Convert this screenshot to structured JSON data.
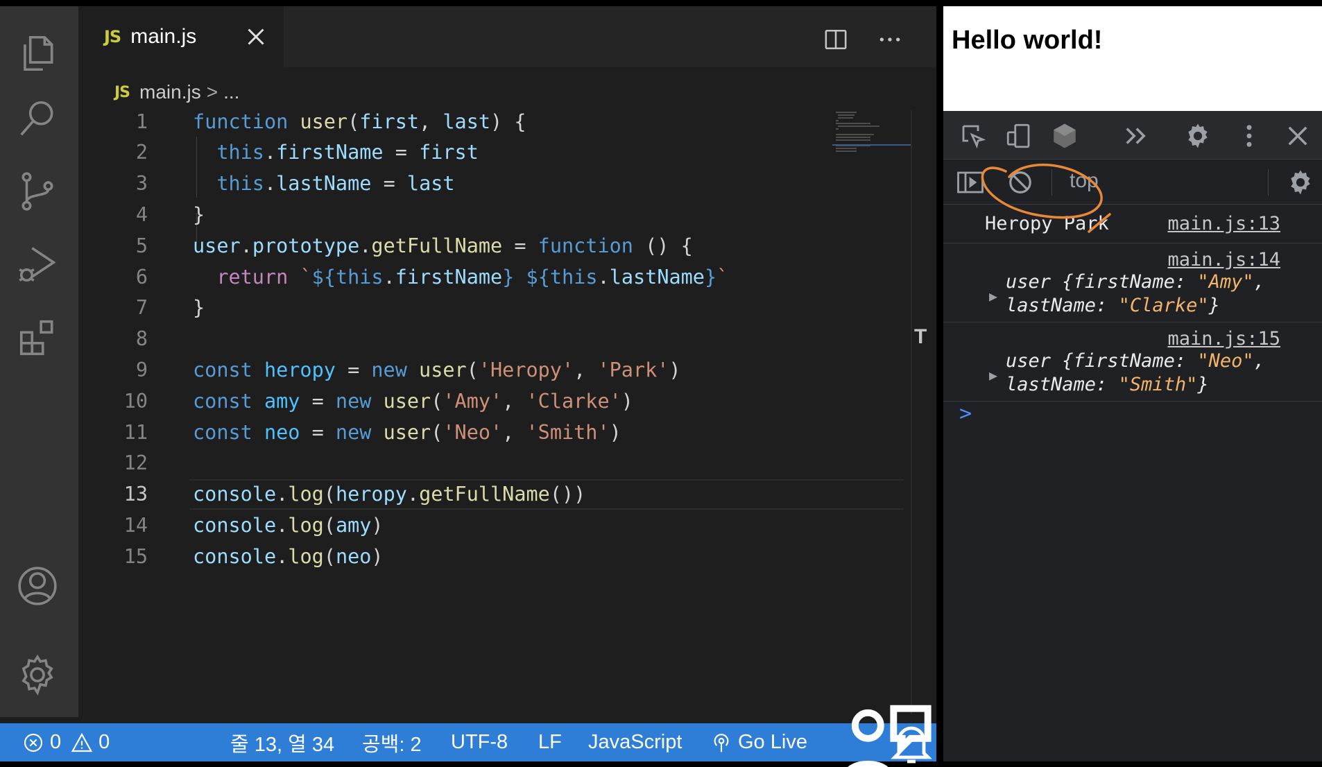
{
  "editor": {
    "tab": {
      "badge": "JS",
      "label": "main.js"
    },
    "breadcrumb": {
      "badge": "JS",
      "file": "main.js",
      "separator": ">",
      "more": "..."
    },
    "lines": [
      {
        "n": "1",
        "tokens": [
          [
            "kw",
            "function "
          ],
          [
            "fn",
            "user"
          ],
          [
            "pun",
            "("
          ],
          [
            "var",
            "first"
          ],
          [
            "pun",
            ", "
          ],
          [
            "var",
            "last"
          ],
          [
            "pun",
            ") {"
          ]
        ]
      },
      {
        "n": "2",
        "tokens": [
          [
            "pun",
            "  "
          ],
          [
            "kw",
            "this"
          ],
          [
            "pun",
            "."
          ],
          [
            "var",
            "firstName"
          ],
          [
            "pun",
            " = "
          ],
          [
            "var",
            "first"
          ]
        ]
      },
      {
        "n": "3",
        "tokens": [
          [
            "pun",
            "  "
          ],
          [
            "kw",
            "this"
          ],
          [
            "pun",
            "."
          ],
          [
            "var",
            "lastName"
          ],
          [
            "pun",
            " = "
          ],
          [
            "var",
            "last"
          ]
        ]
      },
      {
        "n": "4",
        "tokens": [
          [
            "pun",
            "}"
          ]
        ]
      },
      {
        "n": "5",
        "tokens": [
          [
            "var",
            "user"
          ],
          [
            "pun",
            "."
          ],
          [
            "var",
            "prototype"
          ],
          [
            "pun",
            "."
          ],
          [
            "fn",
            "getFullName"
          ],
          [
            "pun",
            " = "
          ],
          [
            "kw",
            "function"
          ],
          [
            "pun",
            " () {"
          ]
        ]
      },
      {
        "n": "6",
        "tokens": [
          [
            "pun",
            "  "
          ],
          [
            "ctrl",
            "return"
          ],
          [
            "pun",
            " "
          ],
          [
            "str",
            "`"
          ],
          [
            "kw",
            "${"
          ],
          [
            "kw",
            "this"
          ],
          [
            "pun",
            "."
          ],
          [
            "var",
            "firstName"
          ],
          [
            "kw",
            "}"
          ],
          [
            "str",
            " "
          ],
          [
            "kw",
            "${"
          ],
          [
            "kw",
            "this"
          ],
          [
            "pun",
            "."
          ],
          [
            "var",
            "lastName"
          ],
          [
            "kw",
            "}"
          ],
          [
            "str",
            "`"
          ]
        ]
      },
      {
        "n": "7",
        "tokens": [
          [
            "pun",
            "}"
          ]
        ]
      },
      {
        "n": "8",
        "tokens": []
      },
      {
        "n": "9",
        "tokens": [
          [
            "kw",
            "const "
          ],
          [
            "cst",
            "heropy"
          ],
          [
            "pun",
            " = "
          ],
          [
            "kw",
            "new "
          ],
          [
            "fn",
            "user"
          ],
          [
            "pun",
            "("
          ],
          [
            "str",
            "'Heropy'"
          ],
          [
            "pun",
            ", "
          ],
          [
            "str",
            "'Park'"
          ],
          [
            "pun",
            ")"
          ]
        ]
      },
      {
        "n": "10",
        "tokens": [
          [
            "kw",
            "const "
          ],
          [
            "cst",
            "amy"
          ],
          [
            "pun",
            " = "
          ],
          [
            "kw",
            "new "
          ],
          [
            "fn",
            "user"
          ],
          [
            "pun",
            "("
          ],
          [
            "str",
            "'Amy'"
          ],
          [
            "pun",
            ", "
          ],
          [
            "str",
            "'Clarke'"
          ],
          [
            "pun",
            ")"
          ]
        ]
      },
      {
        "n": "11",
        "tokens": [
          [
            "kw",
            "const "
          ],
          [
            "cst",
            "neo"
          ],
          [
            "pun",
            " = "
          ],
          [
            "kw",
            "new "
          ],
          [
            "fn",
            "user"
          ],
          [
            "pun",
            "("
          ],
          [
            "str",
            "'Neo'"
          ],
          [
            "pun",
            ", "
          ],
          [
            "str",
            "'Smith'"
          ],
          [
            "pun",
            ")"
          ]
        ]
      },
      {
        "n": "12",
        "tokens": []
      },
      {
        "n": "13",
        "tokens": [
          [
            "var",
            "console"
          ],
          [
            "pun",
            "."
          ],
          [
            "fn",
            "log"
          ],
          [
            "pun",
            "("
          ],
          [
            "var",
            "heropy"
          ],
          [
            "pun",
            "."
          ],
          [
            "fn",
            "getFullName"
          ],
          [
            "pun",
            "())"
          ]
        ]
      },
      {
        "n": "14",
        "tokens": [
          [
            "var",
            "console"
          ],
          [
            "pun",
            "."
          ],
          [
            "fn",
            "log"
          ],
          [
            "pun",
            "("
          ],
          [
            "var",
            "amy"
          ],
          [
            "pun",
            ")"
          ]
        ]
      },
      {
        "n": "15",
        "tokens": [
          [
            "var",
            "console"
          ],
          [
            "pun",
            "."
          ],
          [
            "fn",
            "log"
          ],
          [
            "pun",
            "("
          ],
          [
            "var",
            "neo"
          ],
          [
            "pun",
            ")"
          ]
        ]
      }
    ],
    "active_line": "13"
  },
  "status_bar": {
    "errors": "0",
    "warnings": "0",
    "position": "줄 13, 열 34",
    "spaces": "공백: 2",
    "encoding": "UTF-8",
    "eol": "LF",
    "language": "JavaScript",
    "go_live": "Go Live"
  },
  "browser": {
    "page_heading": "Hello world!",
    "console_context": "top",
    "messages": [
      {
        "text": "Heropy Park",
        "source": "main.js:13"
      },
      {
        "source": "main.js:14",
        "name": "user",
        "line1_key": "firstName",
        "line1_val": "\"Amy\"",
        "line2_key": "lastName",
        "line2_val": "\"Clarke\""
      },
      {
        "source": "main.js:15",
        "name": "user",
        "line1_key": "firstName",
        "line1_val": "\"Neo\"",
        "line2_key": "lastName",
        "line2_val": "\"Smith\""
      }
    ],
    "prompt": ">"
  },
  "icons": {
    "activity_bar": [
      "explorer-icon",
      "search-icon",
      "source-control-icon",
      "run-debug-icon",
      "extensions-icon",
      "account-icon",
      "settings-gear-icon"
    ],
    "accent": "#2e7dd6",
    "annotation_color": "#e8893a"
  }
}
